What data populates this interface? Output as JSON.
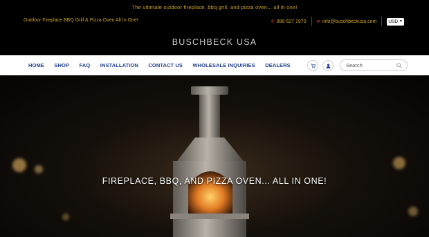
{
  "announcement": "The ultimate outdoor fireplace, bbq grill, and pizza oven... all in one!",
  "topbar": {
    "tagline": "Outdoor Fireplace BBQ Grill & Pizza Oven All In One!",
    "phone": "888 627 1970",
    "email": "info@buschbeckusa.com",
    "currency": "USD"
  },
  "brand": "BUSCHBECK USA",
  "nav": {
    "items": [
      "HOME",
      "SHOP",
      "FAQ",
      "INSTALLATION",
      "CONTACT US",
      "WHOLESALE INQUIRIES",
      "DEALERS"
    ]
  },
  "search": {
    "placeholder": "Search"
  },
  "hero": {
    "title": "FIREPLACE, BBQ, AND PIZZA OVEN... ALL IN ONE!"
  },
  "colors": {
    "accent": "#c9a227",
    "nav": "#1f3f8f",
    "icon_red": "#e04040"
  },
  "icons": [
    "phone-icon",
    "email-icon",
    "cart-icon",
    "user-icon",
    "search-icon"
  ]
}
